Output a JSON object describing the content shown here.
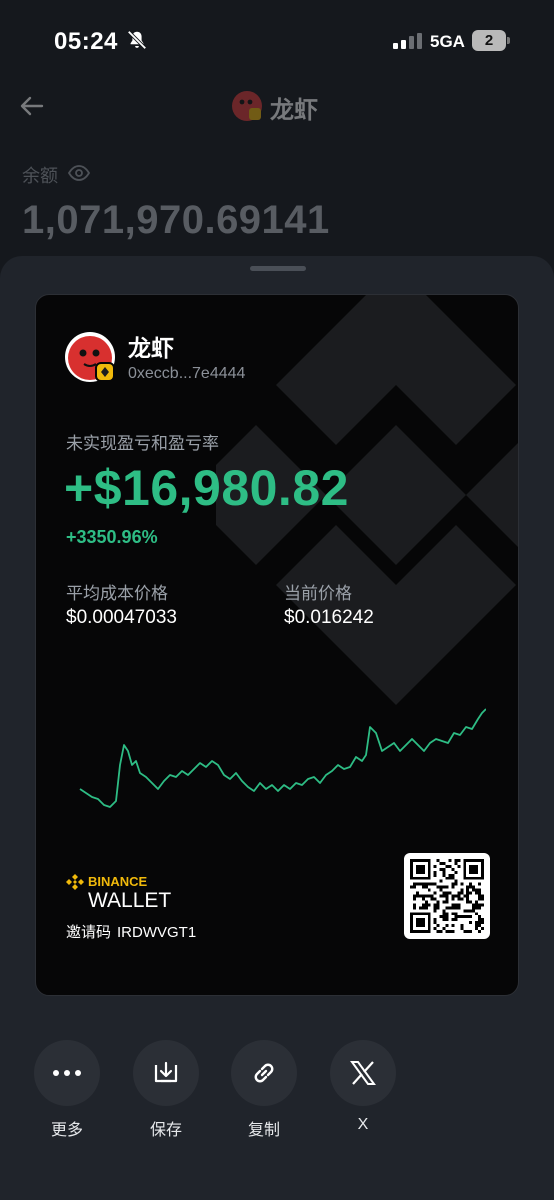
{
  "status_bar": {
    "time": "05:24",
    "network": "5GA",
    "battery": "2",
    "icons": [
      "bell-slash-icon",
      "signal-icon",
      "battery-icon"
    ]
  },
  "header": {
    "title": "龙虾",
    "balance_label": "余额",
    "balance_value": "1,071,970.69141",
    "icons": [
      "back-arrow-icon",
      "token-avatar",
      "eye-icon"
    ]
  },
  "card": {
    "name": "龙虾",
    "address": "0xeccb...7e4444",
    "pnl_label": "未实现盈亏和盈亏率",
    "pnl_value": "+$16,980.82",
    "pnl_percent": "+3350.96%",
    "avg_cost_label": "平均成本价格",
    "avg_cost_value": "$0.00047033",
    "current_price_label": "当前价格",
    "current_price_value": "$0.016242",
    "brand_top": "BINANCE",
    "brand_bottom": "WALLET",
    "invite_label": "邀请码",
    "invite_code": "IRDWVGT1",
    "accent_color": "#2ebd85",
    "brand_color": "#f0b90b"
  },
  "actions": [
    {
      "label": "更多",
      "icon": "more-dots-icon"
    },
    {
      "label": "保存",
      "icon": "save-download-icon"
    },
    {
      "label": "复制",
      "icon": "link-icon"
    },
    {
      "label": "X",
      "icon": "x-logo-icon"
    }
  ]
}
